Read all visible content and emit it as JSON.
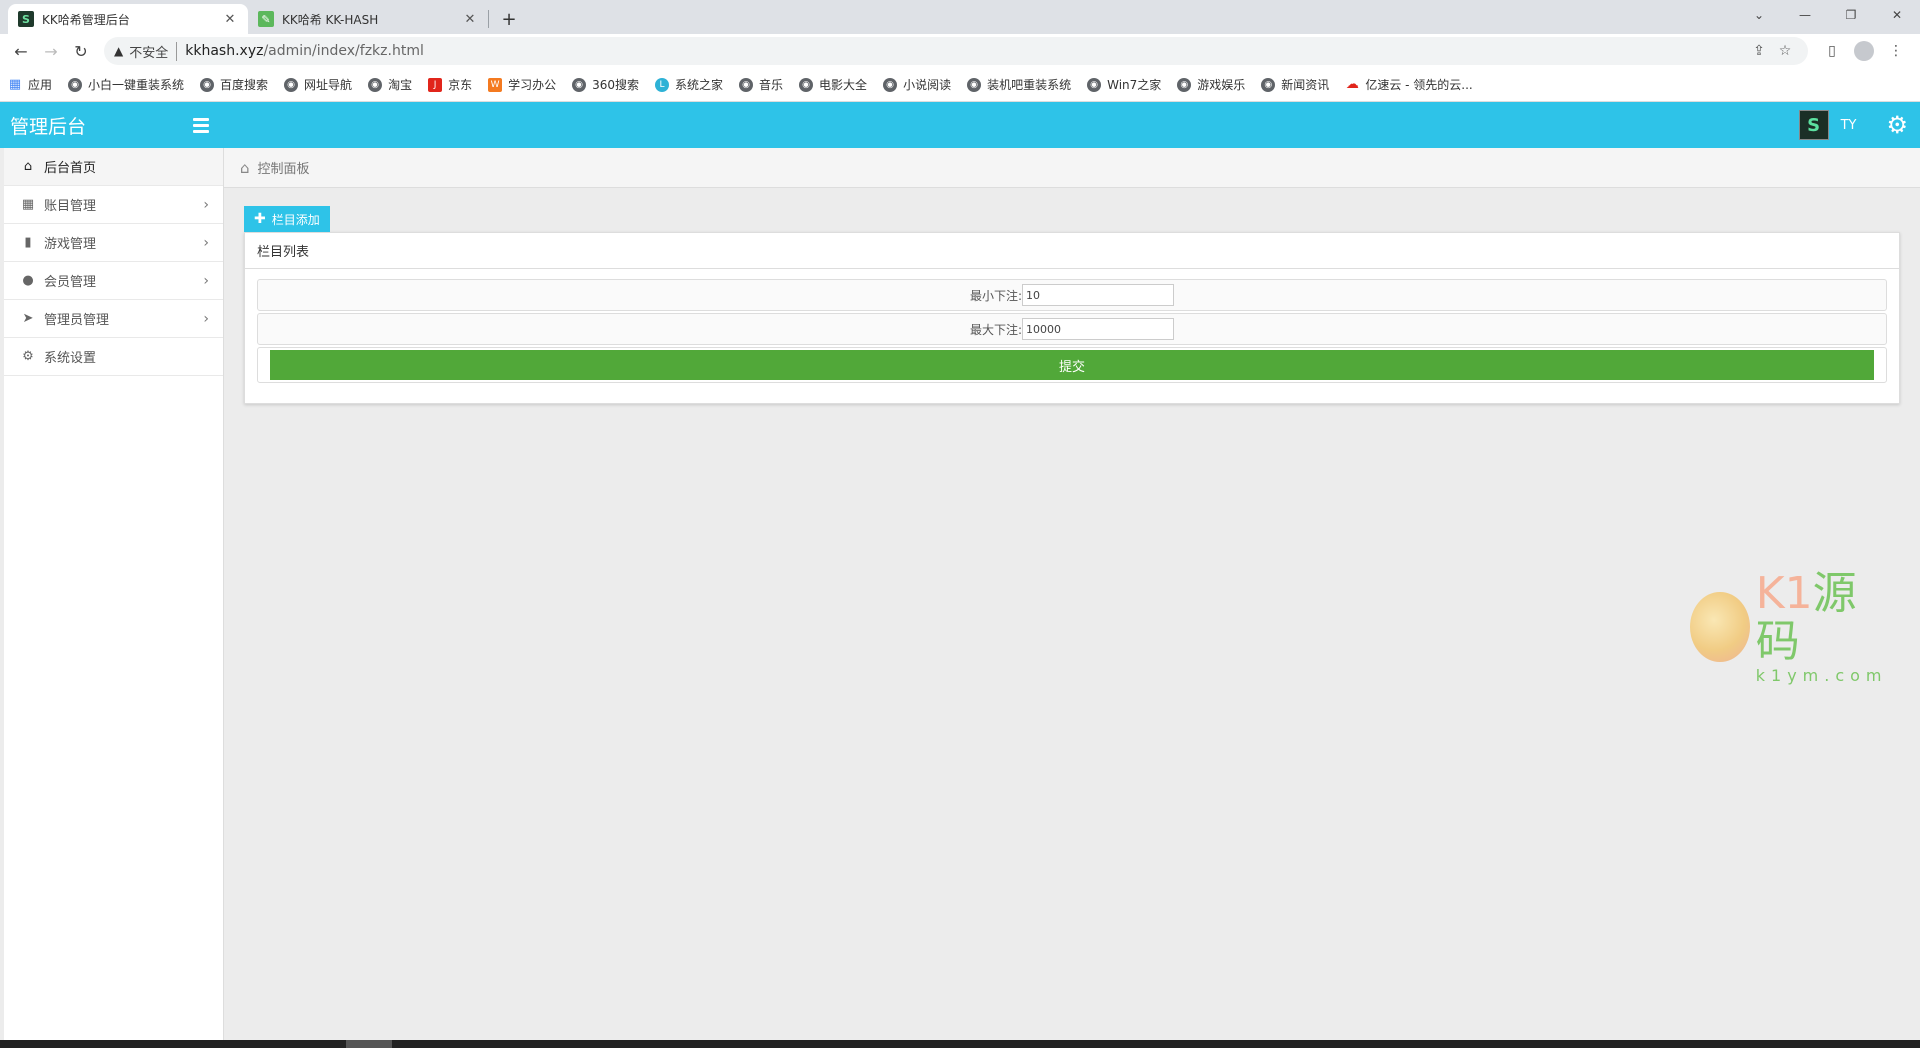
{
  "browser": {
    "tabs": [
      {
        "title": "KK哈希管理后台",
        "favicon": "s-logo-icon",
        "active": true
      },
      {
        "title": "KK哈希 KK-HASH",
        "favicon": "leaf-icon",
        "active": false
      }
    ],
    "address": {
      "security_label": "不安全",
      "url_host": "kkhash.xyz",
      "url_path": "/admin/index/fzkz.html"
    },
    "bookmarks": [
      {
        "label": "应用",
        "icon": "apps-grid-icon"
      },
      {
        "label": "小白一键重装系统",
        "icon": "globe-icon"
      },
      {
        "label": "百度搜索",
        "icon": "globe-icon"
      },
      {
        "label": "网址导航",
        "icon": "globe-icon"
      },
      {
        "label": "淘宝",
        "icon": "globe-icon"
      },
      {
        "label": "京东",
        "icon": "jd-icon"
      },
      {
        "label": "学习办公",
        "icon": "study-icon"
      },
      {
        "label": "360搜索",
        "icon": "globe-icon"
      },
      {
        "label": "系统之家",
        "icon": "system-home-icon"
      },
      {
        "label": "音乐",
        "icon": "globe-icon"
      },
      {
        "label": "电影大全",
        "icon": "globe-icon"
      },
      {
        "label": "小说阅读",
        "icon": "globe-icon"
      },
      {
        "label": "装机吧重装系统",
        "icon": "globe-icon"
      },
      {
        "label": "Win7之家",
        "icon": "globe-icon"
      },
      {
        "label": "游戏娱乐",
        "icon": "globe-icon"
      },
      {
        "label": "新闻资讯",
        "icon": "globe-icon"
      },
      {
        "label": "亿速云 - 领先的云...",
        "icon": "cloud-icon"
      }
    ]
  },
  "app": {
    "brand": "管理后台",
    "user": {
      "avatar_letter": "S",
      "name": "TY"
    },
    "sidebar": [
      {
        "label": "后台首页",
        "icon": "home-icon",
        "active": true,
        "has_arrow": false
      },
      {
        "label": "账目管理",
        "icon": "grid-icon",
        "active": false,
        "has_arrow": true
      },
      {
        "label": "游戏管理",
        "icon": "book-icon",
        "active": false,
        "has_arrow": true
      },
      {
        "label": "会员管理",
        "icon": "user-icon",
        "active": false,
        "has_arrow": true
      },
      {
        "label": "管理员管理",
        "icon": "send-icon",
        "active": false,
        "has_arrow": true
      },
      {
        "label": "系统设置",
        "icon": "gear-icon",
        "active": false,
        "has_arrow": false
      }
    ],
    "breadcrumb": "控制面板",
    "add_button": "栏目添加",
    "panel_title": "栏目列表",
    "form": {
      "min_bet_label": "最小下注:",
      "min_bet_value": "10",
      "max_bet_label": "最大下注:",
      "max_bet_value": "10000",
      "submit_label": "提交"
    },
    "watermark": {
      "brand_k1": "K1",
      "brand_cn": "源码",
      "domain": "k1ym.com"
    }
  }
}
